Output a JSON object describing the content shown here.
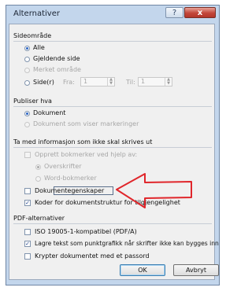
{
  "window": {
    "title": "Alternativer",
    "help_glyph": "?",
    "close_glyph": "x"
  },
  "page_range": {
    "label": "Sideområde",
    "options": [
      {
        "label": "Alle",
        "selected": true,
        "enabled": true
      },
      {
        "label": "Gjeldende side",
        "selected": false,
        "enabled": true
      },
      {
        "label": "Merket område",
        "selected": false,
        "enabled": false
      },
      {
        "label": "Side(r)",
        "selected": false,
        "enabled": true
      }
    ],
    "from_label": "Fra:",
    "from_value": "1",
    "to_label": "Til:",
    "to_value": "1"
  },
  "publish": {
    "label": "Publiser hva",
    "options": [
      {
        "label": "Dokument",
        "selected": true,
        "enabled": true
      },
      {
        "label": "Dokument som viser markeringer",
        "selected": false,
        "enabled": false
      }
    ]
  },
  "nonprint": {
    "label": "Ta med informasjon som ikke skal skrives ut",
    "create_bookmarks": {
      "label": "Opprett bokmerker ved hjelp av:",
      "checked": false,
      "enabled": false
    },
    "bookmark_options": [
      {
        "label": "Overskrifter",
        "selected": true,
        "enabled": false
      },
      {
        "label": "Word-bokmerker",
        "selected": false,
        "enabled": false
      }
    ],
    "doc_properties": {
      "label": "Dokumentegenskaper",
      "checked": false,
      "enabled": true
    },
    "structure_tags": {
      "label": "Koder for dokumentstruktur for tilgjengelighet",
      "checked": true,
      "enabled": true
    }
  },
  "pdf": {
    "label": "PDF-alternativer",
    "options": [
      {
        "label": "ISO 19005-1-kompatibel (PDF/A)",
        "checked": false
      },
      {
        "label": "Lagre tekst som punktgrafikk når skrifter ikke kan bygges inn",
        "checked": true
      },
      {
        "label": "Krypter dokumentet med et passord",
        "checked": false
      }
    ]
  },
  "buttons": {
    "ok": "OK",
    "cancel": "Avbryt"
  },
  "colors": {
    "annotation_arrow": "#e0262b",
    "selection_accent": "#2b63c4"
  }
}
